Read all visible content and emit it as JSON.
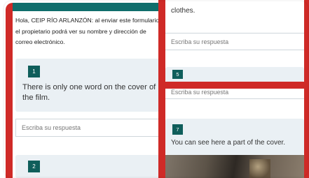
{
  "privacy_notice": "Hola, CEIP RÍO ARLANZÓN: al enviar este formulario, el propietario podrá ver su nombre y dirección de correo electrónico.",
  "questions": [
    {
      "number": "1",
      "text": "There is only one word on the cover of the film."
    },
    {
      "number": "2"
    },
    {
      "number": "5"
    },
    {
      "number": "7",
      "text": "You can see here a part of the cover."
    }
  ],
  "right_top": {
    "partial_text": "clothes."
  },
  "answer_placeholder": "Escriba su respuesta",
  "colors": {
    "accent_red": "#cf2a27",
    "teal": "#0f6e6c",
    "card_bg": "#eaf0f4"
  }
}
